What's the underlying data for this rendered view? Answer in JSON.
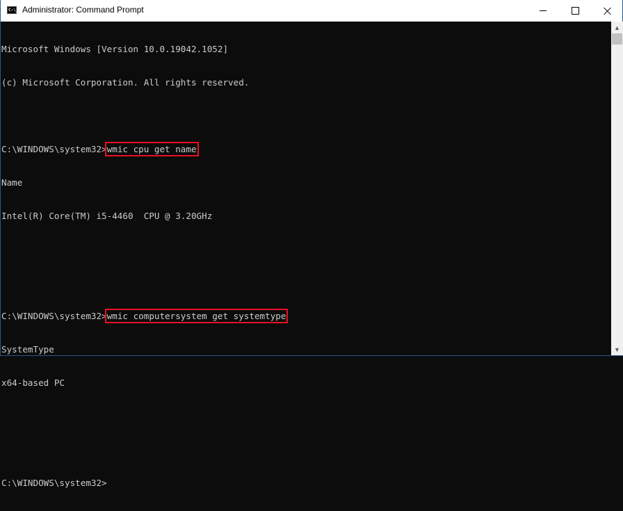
{
  "window": {
    "title": "Administrator: Command Prompt",
    "icon": "cmd-icon",
    "icon_text": "C:\\_",
    "controls": {
      "minimize": "minimize-icon",
      "maximize": "maximize-icon",
      "close": "close-icon"
    }
  },
  "console": {
    "lines": [
      {
        "text": "Microsoft Windows [Version 10.0.19042.1052]"
      },
      {
        "text": "(c) Microsoft Corporation. All rights reserved."
      },
      {
        "text": ""
      },
      {
        "prompt": "C:\\WINDOWS\\system32>",
        "command": "wmic cpu get name",
        "highlighted": true
      },
      {
        "text": "Name"
      },
      {
        "text": "Intel(R) Core(TM) i5-4460  CPU @ 3.20GHz"
      },
      {
        "text": ""
      },
      {
        "text": ""
      },
      {
        "prompt": "C:\\WINDOWS\\system32>",
        "command": "wmic computersystem get systemtype",
        "highlighted": true
      },
      {
        "text": "SystemType"
      },
      {
        "text": "x64-based PC"
      },
      {
        "text": ""
      },
      {
        "text": ""
      },
      {
        "prompt": "C:\\WINDOWS\\system32>",
        "command": ""
      }
    ],
    "highlight_color": "#e81123",
    "text_color": "#cccccc",
    "background_color": "#0c0c0c"
  },
  "scrollbar": {
    "up_arrow": "▲",
    "down_arrow": "▼"
  }
}
